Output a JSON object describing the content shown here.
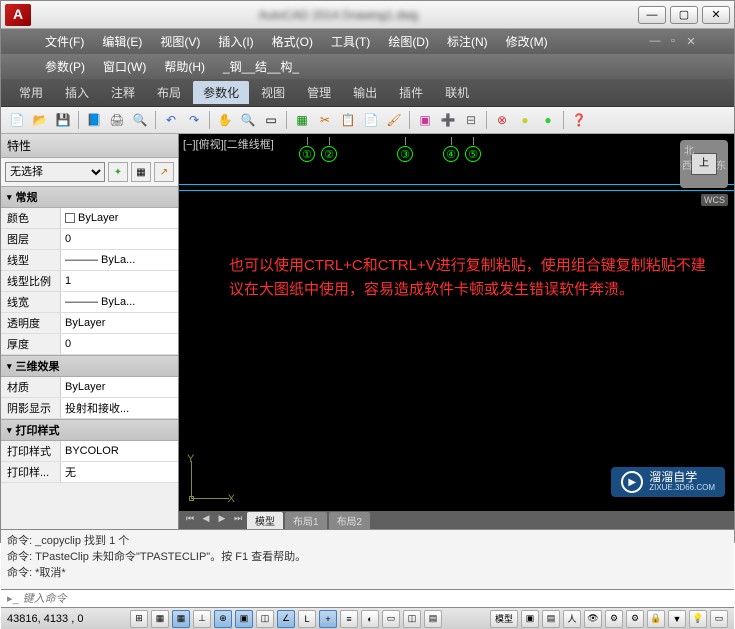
{
  "app": {
    "logo_letter": "A",
    "title": "AutoCAD 2014 Drawing1.dwg"
  },
  "window_controls": {
    "min": "—",
    "max": "▢",
    "close": "✕"
  },
  "menu": {
    "row1": [
      "文件(F)",
      "编辑(E)",
      "视图(V)",
      "插入(I)",
      "格式(O)",
      "工具(T)",
      "绘图(D)",
      "标注(N)",
      "修改(M)"
    ],
    "row2": [
      "参数(P)",
      "窗口(W)",
      "帮助(H)",
      "_钢__结__构_"
    ]
  },
  "tabs": [
    "常用",
    "插入",
    "注释",
    "布局",
    "参数化",
    "视图",
    "管理",
    "输出",
    "插件",
    "联机"
  ],
  "active_tab_index": 4,
  "properties": {
    "title": "特性",
    "selection": "无选择",
    "groups": {
      "general": {
        "label": "常规",
        "items": [
          {
            "label": "颜色",
            "value": "ByLayer",
            "swatch": true
          },
          {
            "label": "图层",
            "value": "0"
          },
          {
            "label": "线型",
            "value": "——— ByLa...",
            "line": true
          },
          {
            "label": "线型比例",
            "value": "1"
          },
          {
            "label": "线宽",
            "value": "——— ByLa...",
            "line": true
          },
          {
            "label": "透明度",
            "value": "ByLayer"
          },
          {
            "label": "厚度",
            "value": "0"
          }
        ]
      },
      "threed": {
        "label": "三维效果",
        "items": [
          {
            "label": "材质",
            "value": "ByLayer"
          },
          {
            "label": "阴影显示",
            "value": "投射和接收..."
          }
        ]
      },
      "plot": {
        "label": "打印样式",
        "items": [
          {
            "label": "打印样式",
            "value": "BYCOLOR"
          },
          {
            "label": "打印样...",
            "value": "无"
          }
        ]
      }
    }
  },
  "viewport": {
    "label": "[−][俯视][二维线框]",
    "markers": [
      "①",
      "②",
      "③",
      "④",
      "⑤"
    ],
    "nav_face": "上",
    "nav_n": "北",
    "nav_e": "东",
    "nav_w": "西",
    "wcs": "WCS",
    "ucs_x": "X",
    "ucs_y": "Y",
    "overlay_text": "也可以使用CTRL+C和CTRL+V进行复制粘贴，使用组合键复制粘贴不建议在大图纸中使用，容易造成软件卡顿或发生错误软件奔溃。"
  },
  "layout_tabs": {
    "nav": [
      "⏮",
      "◀",
      "▶",
      "⏭"
    ],
    "items": [
      "模型",
      "布局1",
      "布局2"
    ],
    "active_index": 0
  },
  "command": {
    "lines": [
      "命令: _copyclip 找到 1 个",
      "命令: TPasteClip 未知命令\"TPASTECLIP\"。按 F1 查看帮助。",
      "命令: *取消*"
    ],
    "prompt": "键入命令"
  },
  "status": {
    "coords": "43816, 4133 , 0",
    "model_label": "模型"
  },
  "watermark": {
    "brand": "溜溜自学",
    "url": "ZIXUE.3D66.COM"
  },
  "icons": {
    "new": "📄",
    "open": "📂",
    "save": "💾",
    "undo": "↶",
    "redo": "↷",
    "cut": "✂",
    "copy": "📋",
    "paste": "📄",
    "match": "🖌",
    "qnew2": "📄",
    "plot": "🖨",
    "preview": "🔍",
    "pan": "✋",
    "zoom": "🔍",
    "help": "❓",
    "layer": "▦",
    "grid": "▦",
    "snap": "◫",
    "ortho": "⊥",
    "polar": "⊕",
    "osnap": "▣"
  }
}
